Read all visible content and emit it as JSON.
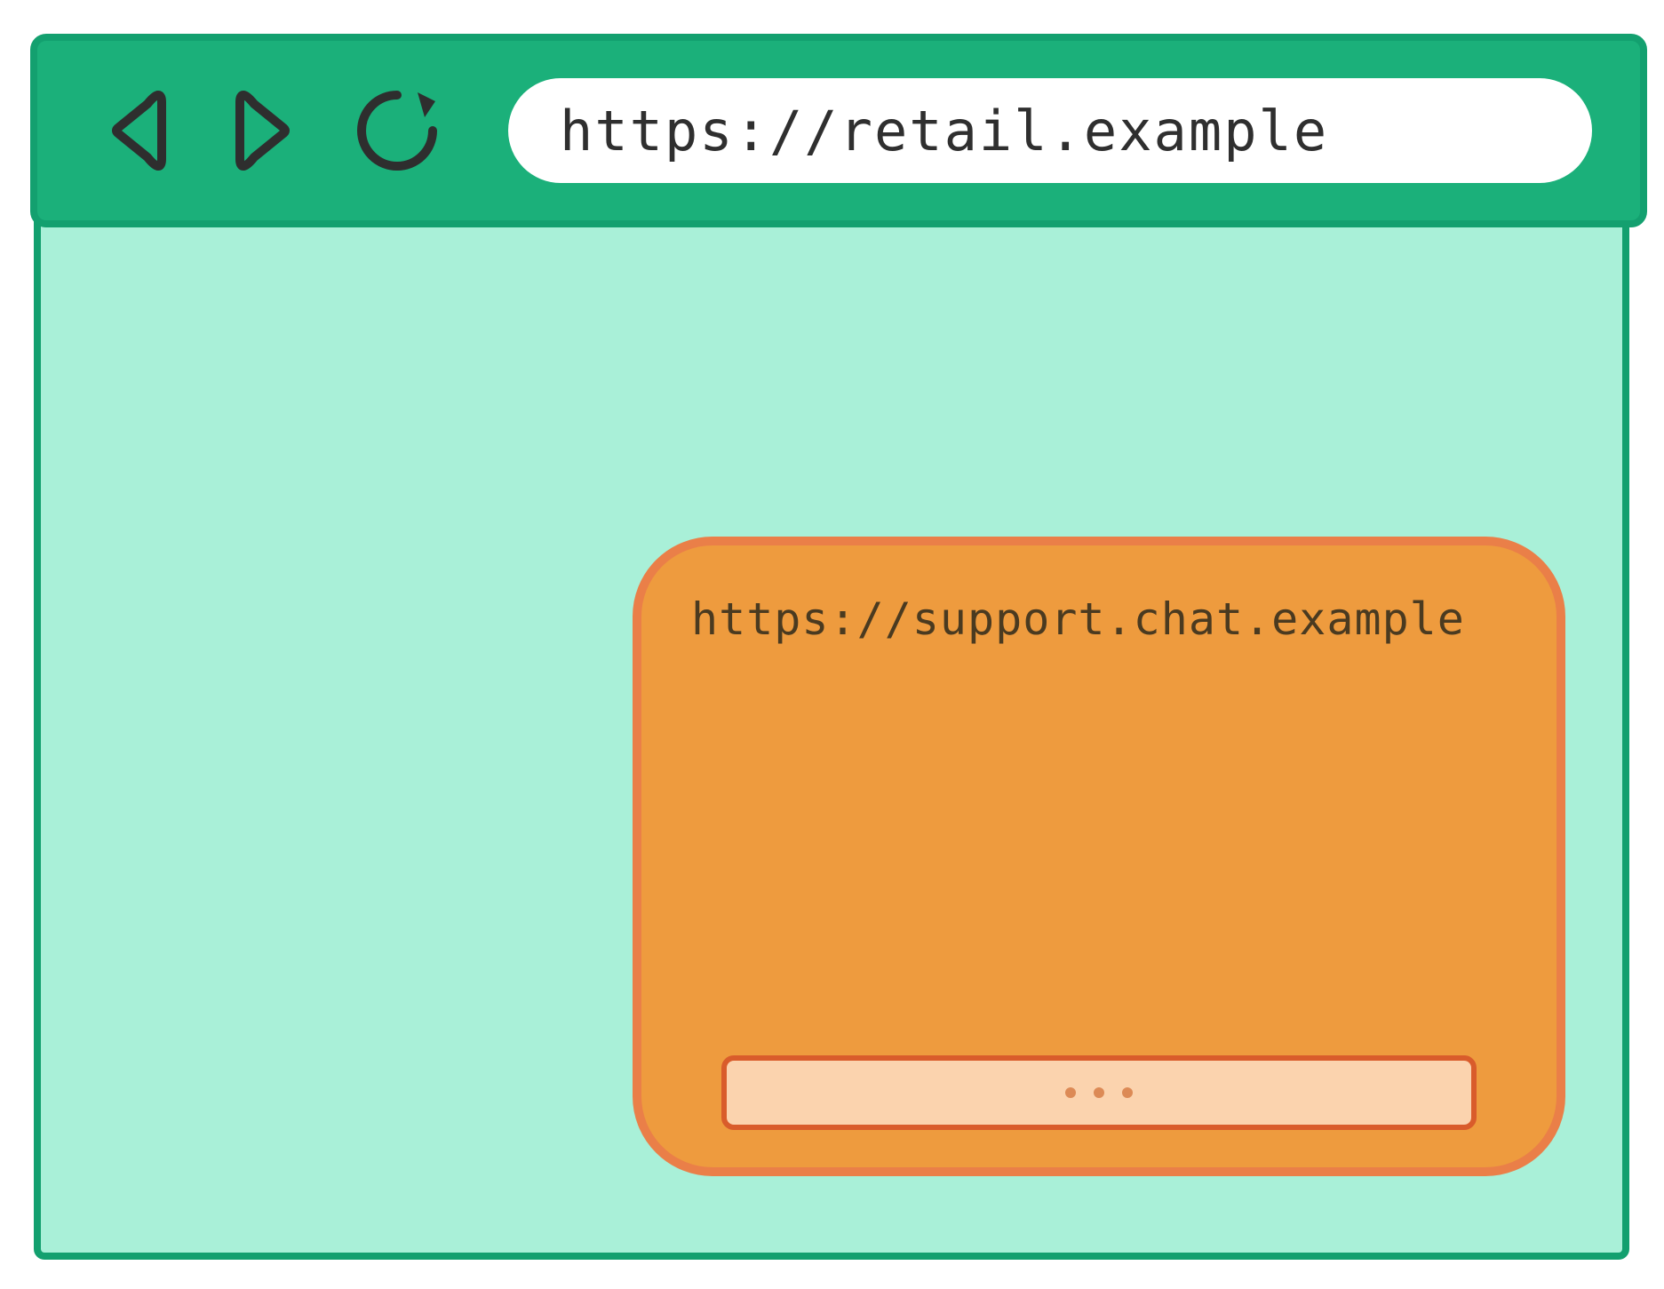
{
  "browser": {
    "url": "https://retail.example"
  },
  "chat_widget": {
    "origin": "https://support.chat.example"
  },
  "colors": {
    "toolbar_bg": "#1bb07a",
    "toolbar_border": "#13a06f",
    "page_bg": "#a9f0d8",
    "widget_bg": "#ee9b3e",
    "widget_border": "#ea7f48",
    "input_bg": "#fbd3ae",
    "input_border": "#d95c2b"
  }
}
